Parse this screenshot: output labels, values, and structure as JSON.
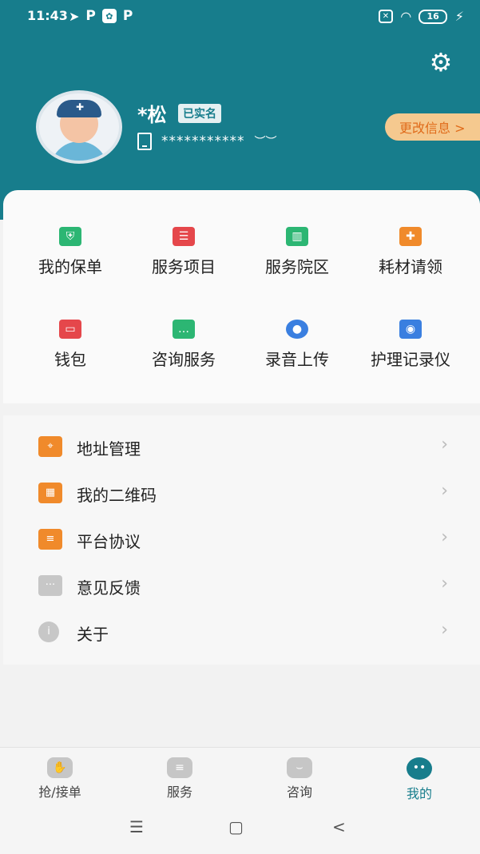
{
  "status_bar": {
    "time": "11:43",
    "left_icons": [
      "location-arrow-icon",
      "P",
      "app-icon",
      "P"
    ],
    "battery": "16"
  },
  "profile": {
    "name": "*松",
    "verified_badge": "已实名",
    "phone": "***********",
    "edit_button": "更改信息 >"
  },
  "grid": [
    {
      "label": "我的保单",
      "icon": "policy-shield-icon",
      "color": "#2cb673"
    },
    {
      "label": "服务项目",
      "icon": "folder-list-icon",
      "color": "#e5474b"
    },
    {
      "label": "服务院区",
      "icon": "building-icon",
      "color": "#2cb673"
    },
    {
      "label": "耗材请领",
      "icon": "medkit-icon",
      "color": "#f08a2b"
    },
    {
      "label": "钱包",
      "icon": "wallet-icon",
      "color": "#e5474b"
    },
    {
      "label": "咨询服务",
      "icon": "chat-icon",
      "color": "#2cb673"
    },
    {
      "label": "录音上传",
      "icon": "microphone-icon",
      "color": "#3a7fe0"
    },
    {
      "label": "护理记录仪",
      "icon": "recorder-icon",
      "color": "#3a7fe0"
    }
  ],
  "menu": [
    {
      "label": "地址管理",
      "icon": "address-icon",
      "color": "#f08a2b"
    },
    {
      "label": "我的二维码",
      "icon": "qrcode-icon",
      "color": "#f08a2b"
    },
    {
      "label": "平台协议",
      "icon": "agreement-icon",
      "color": "#f08a2b"
    },
    {
      "label": "意见反馈",
      "icon": "feedback-icon",
      "color": "#c7c7c7"
    },
    {
      "label": "关于",
      "icon": "info-icon",
      "color": "#c7c7c7"
    }
  ],
  "tabs": [
    {
      "label": "抢/接单",
      "icon": "hand-icon"
    },
    {
      "label": "服务",
      "icon": "service-icon"
    },
    {
      "label": "咨询",
      "icon": "consult-icon"
    },
    {
      "label": "我的",
      "icon": "profile-icon",
      "active": true
    }
  ],
  "nav": {
    "menu_symbol": "☰",
    "home_symbol": "▢",
    "back_symbol": "<"
  }
}
